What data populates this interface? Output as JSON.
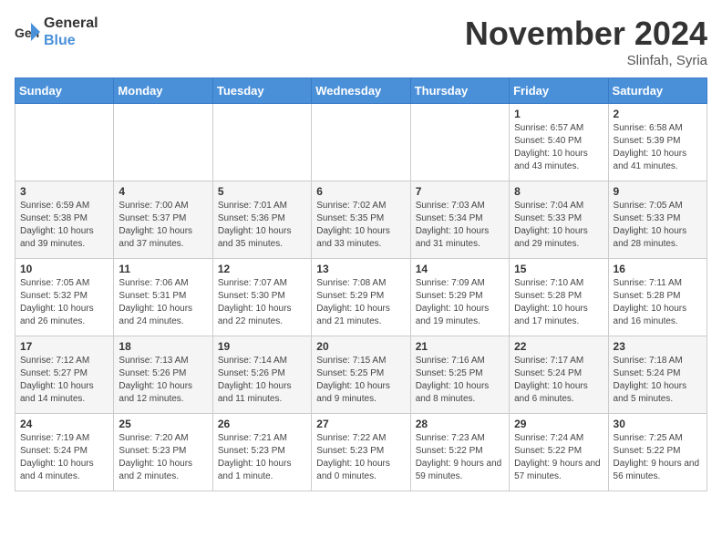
{
  "header": {
    "logo_line1": "General",
    "logo_line2": "Blue",
    "month": "November 2024",
    "location": "Slinfah, Syria"
  },
  "weekdays": [
    "Sunday",
    "Monday",
    "Tuesday",
    "Wednesday",
    "Thursday",
    "Friday",
    "Saturday"
  ],
  "weeks": [
    [
      {
        "day": "",
        "info": ""
      },
      {
        "day": "",
        "info": ""
      },
      {
        "day": "",
        "info": ""
      },
      {
        "day": "",
        "info": ""
      },
      {
        "day": "",
        "info": ""
      },
      {
        "day": "1",
        "info": "Sunrise: 6:57 AM\nSunset: 5:40 PM\nDaylight: 10 hours and 43 minutes."
      },
      {
        "day": "2",
        "info": "Sunrise: 6:58 AM\nSunset: 5:39 PM\nDaylight: 10 hours and 41 minutes."
      }
    ],
    [
      {
        "day": "3",
        "info": "Sunrise: 6:59 AM\nSunset: 5:38 PM\nDaylight: 10 hours and 39 minutes."
      },
      {
        "day": "4",
        "info": "Sunrise: 7:00 AM\nSunset: 5:37 PM\nDaylight: 10 hours and 37 minutes."
      },
      {
        "day": "5",
        "info": "Sunrise: 7:01 AM\nSunset: 5:36 PM\nDaylight: 10 hours and 35 minutes."
      },
      {
        "day": "6",
        "info": "Sunrise: 7:02 AM\nSunset: 5:35 PM\nDaylight: 10 hours and 33 minutes."
      },
      {
        "day": "7",
        "info": "Sunrise: 7:03 AM\nSunset: 5:34 PM\nDaylight: 10 hours and 31 minutes."
      },
      {
        "day": "8",
        "info": "Sunrise: 7:04 AM\nSunset: 5:33 PM\nDaylight: 10 hours and 29 minutes."
      },
      {
        "day": "9",
        "info": "Sunrise: 7:05 AM\nSunset: 5:33 PM\nDaylight: 10 hours and 28 minutes."
      }
    ],
    [
      {
        "day": "10",
        "info": "Sunrise: 7:05 AM\nSunset: 5:32 PM\nDaylight: 10 hours and 26 minutes."
      },
      {
        "day": "11",
        "info": "Sunrise: 7:06 AM\nSunset: 5:31 PM\nDaylight: 10 hours and 24 minutes."
      },
      {
        "day": "12",
        "info": "Sunrise: 7:07 AM\nSunset: 5:30 PM\nDaylight: 10 hours and 22 minutes."
      },
      {
        "day": "13",
        "info": "Sunrise: 7:08 AM\nSunset: 5:29 PM\nDaylight: 10 hours and 21 minutes."
      },
      {
        "day": "14",
        "info": "Sunrise: 7:09 AM\nSunset: 5:29 PM\nDaylight: 10 hours and 19 minutes."
      },
      {
        "day": "15",
        "info": "Sunrise: 7:10 AM\nSunset: 5:28 PM\nDaylight: 10 hours and 17 minutes."
      },
      {
        "day": "16",
        "info": "Sunrise: 7:11 AM\nSunset: 5:28 PM\nDaylight: 10 hours and 16 minutes."
      }
    ],
    [
      {
        "day": "17",
        "info": "Sunrise: 7:12 AM\nSunset: 5:27 PM\nDaylight: 10 hours and 14 minutes."
      },
      {
        "day": "18",
        "info": "Sunrise: 7:13 AM\nSunset: 5:26 PM\nDaylight: 10 hours and 12 minutes."
      },
      {
        "day": "19",
        "info": "Sunrise: 7:14 AM\nSunset: 5:26 PM\nDaylight: 10 hours and 11 minutes."
      },
      {
        "day": "20",
        "info": "Sunrise: 7:15 AM\nSunset: 5:25 PM\nDaylight: 10 hours and 9 minutes."
      },
      {
        "day": "21",
        "info": "Sunrise: 7:16 AM\nSunset: 5:25 PM\nDaylight: 10 hours and 8 minutes."
      },
      {
        "day": "22",
        "info": "Sunrise: 7:17 AM\nSunset: 5:24 PM\nDaylight: 10 hours and 6 minutes."
      },
      {
        "day": "23",
        "info": "Sunrise: 7:18 AM\nSunset: 5:24 PM\nDaylight: 10 hours and 5 minutes."
      }
    ],
    [
      {
        "day": "24",
        "info": "Sunrise: 7:19 AM\nSunset: 5:24 PM\nDaylight: 10 hours and 4 minutes."
      },
      {
        "day": "25",
        "info": "Sunrise: 7:20 AM\nSunset: 5:23 PM\nDaylight: 10 hours and 2 minutes."
      },
      {
        "day": "26",
        "info": "Sunrise: 7:21 AM\nSunset: 5:23 PM\nDaylight: 10 hours and 1 minute."
      },
      {
        "day": "27",
        "info": "Sunrise: 7:22 AM\nSunset: 5:23 PM\nDaylight: 10 hours and 0 minutes."
      },
      {
        "day": "28",
        "info": "Sunrise: 7:23 AM\nSunset: 5:22 PM\nDaylight: 9 hours and 59 minutes."
      },
      {
        "day": "29",
        "info": "Sunrise: 7:24 AM\nSunset: 5:22 PM\nDaylight: 9 hours and 57 minutes."
      },
      {
        "day": "30",
        "info": "Sunrise: 7:25 AM\nSunset: 5:22 PM\nDaylight: 9 hours and 56 minutes."
      }
    ]
  ]
}
